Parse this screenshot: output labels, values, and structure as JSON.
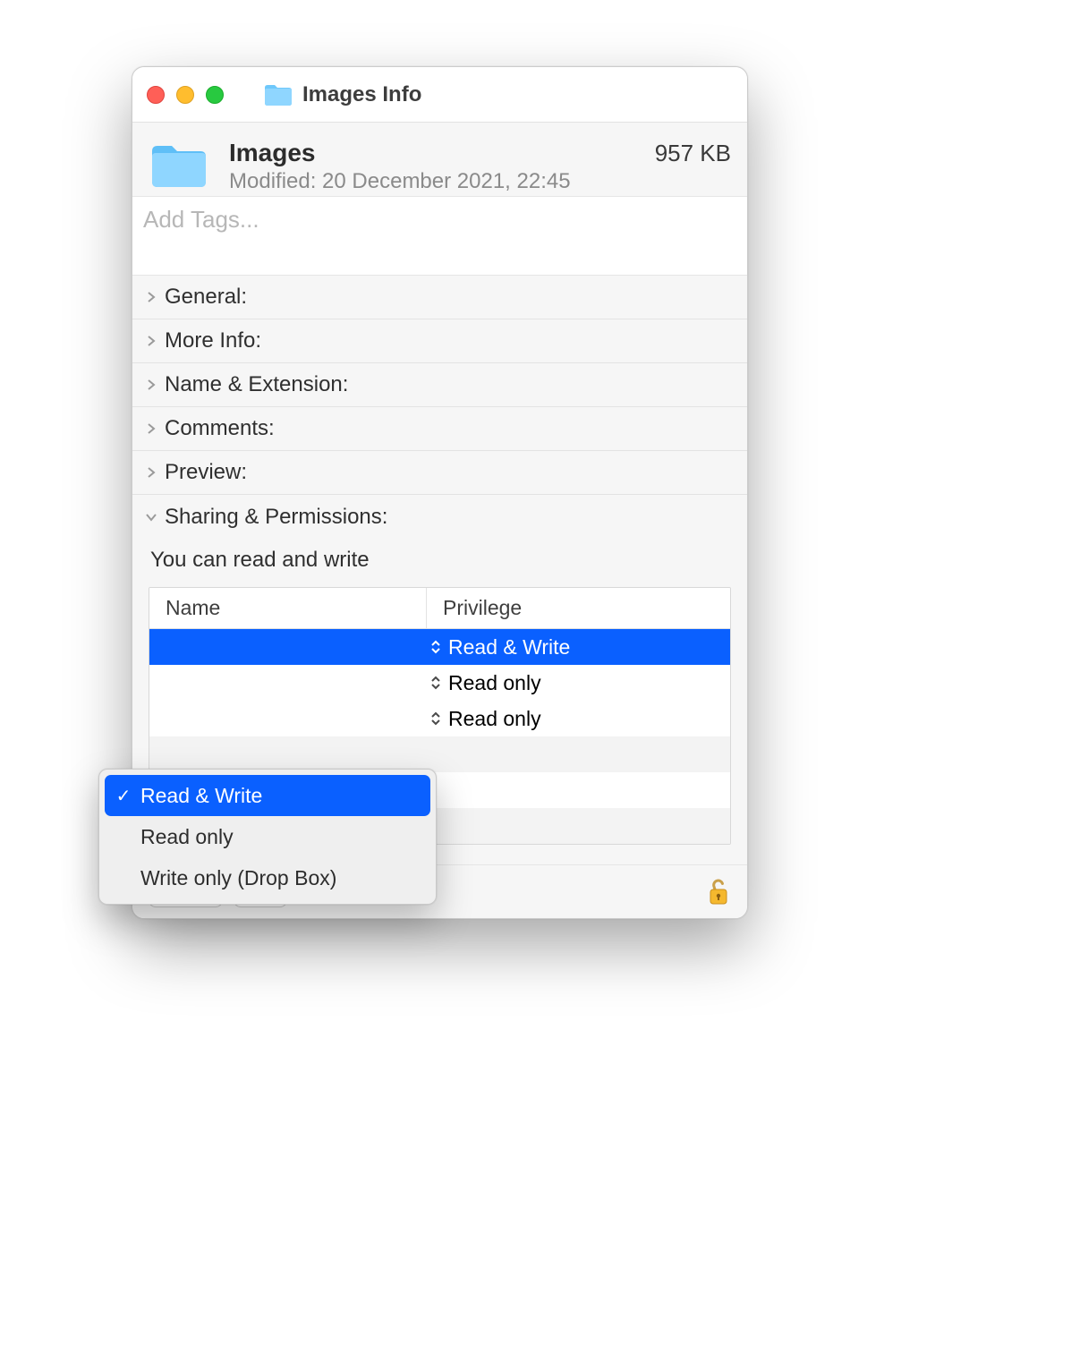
{
  "window": {
    "title": "Images Info"
  },
  "item": {
    "name": "Images",
    "size": "957 KB",
    "modified": "Modified: 20 December 2021, 22:45"
  },
  "tags": {
    "placeholder": "Add Tags..."
  },
  "sections": {
    "general": "General:",
    "moreinfo": "More Info:",
    "nameext": "Name & Extension:",
    "comments": "Comments:",
    "preview": "Preview:",
    "sharing": "Sharing & Permissions:"
  },
  "permissions": {
    "summary": "You can read and write",
    "columns": {
      "name": "Name",
      "privilege": "Privilege"
    },
    "rows": [
      {
        "privilege": "Read & Write",
        "selected": true
      },
      {
        "privilege": "Read only",
        "selected": false
      },
      {
        "privilege": "Read only",
        "selected": false
      }
    ]
  },
  "dropdown": {
    "options": [
      {
        "label": "Read & Write",
        "checked": true
      },
      {
        "label": "Read only",
        "checked": false
      },
      {
        "label": "Write only (Drop Box)",
        "checked": false
      }
    ]
  }
}
